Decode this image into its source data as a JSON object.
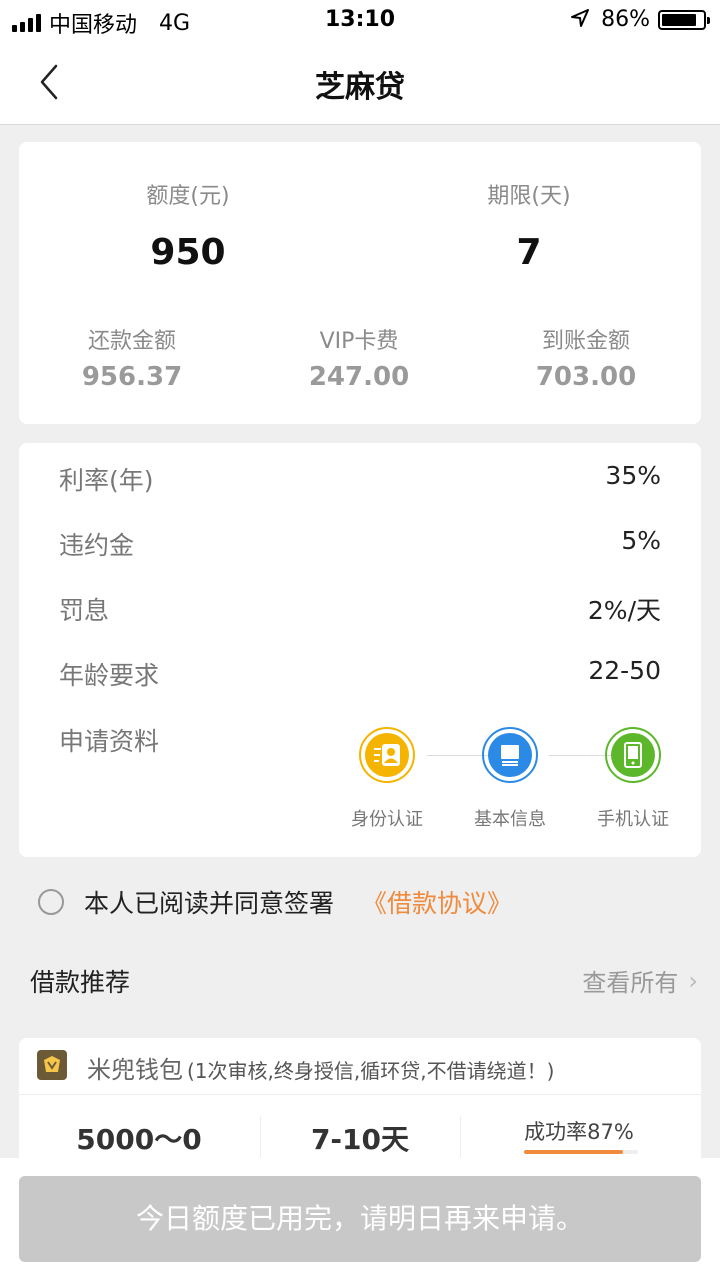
{
  "status_bar": {
    "carrier": "中国移动",
    "network": "4G",
    "time": "13:10",
    "battery_text": "86%",
    "battery_level": 0.86
  },
  "nav": {
    "title": "芝麻贷"
  },
  "summary": {
    "quota_label": "额度(元)",
    "quota_value": "950",
    "term_label": "期限(天)",
    "term_value": "7",
    "repay_label": "还款金额",
    "repay_value": "956.37",
    "vip_label": "VIP卡费",
    "vip_value": "247.00",
    "arrival_label": "到账金额",
    "arrival_value": "703.00"
  },
  "details": [
    {
      "label": "利率(年)",
      "value": "35%"
    },
    {
      "label": "违约金",
      "value": "5%"
    },
    {
      "label": "罚息",
      "value": "2%/天"
    },
    {
      "label": "年龄要求",
      "value": "22-50"
    }
  ],
  "materials": {
    "label": "申请资料",
    "steps": [
      {
        "label": "身份认证",
        "icon": "id-card-icon",
        "color": "#f5b400"
      },
      {
        "label": "基本信息",
        "icon": "info-doc-icon",
        "color": "#2b8ae6"
      },
      {
        "label": "手机认证",
        "icon": "phone-icon",
        "color": "#5cb82a"
      }
    ]
  },
  "agreement": {
    "text": "本人已阅读并同意签署",
    "link": "《借款协议》"
  },
  "recommend": {
    "title": "借款推荐",
    "more": "查看所有",
    "product": {
      "name": "米兜钱包",
      "desc": "(1次审核,终身授信,循环贷,不借请绕道！)",
      "amount": "5000～0",
      "term": "7-10天",
      "success_rate": "成功率87%",
      "success_fraction": 0.87
    }
  },
  "submit": {
    "label": "今日额度已用完，请明日再来申请。"
  },
  "colors": {
    "accent": "#f08a3c",
    "disabled_button": "#c8c8c8"
  }
}
